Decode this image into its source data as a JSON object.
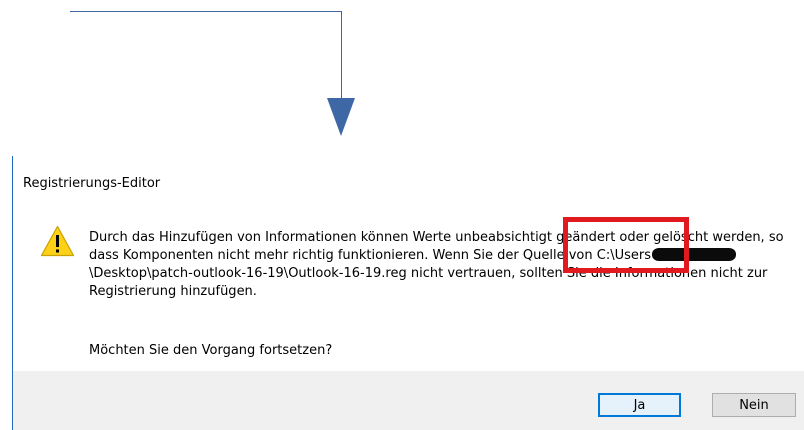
{
  "dialog": {
    "title": "Registrierungs-Editor",
    "message_part1": "Durch das Hinzufügen von Informationen können Werte unbeabsichtigt geändert oder gelöscht werden, so dass Komponenten nicht mehr richtig funktionieren. Wenn Sie der Quelle von C:\\Users",
    "message_part2": "\\Desktop\\patch-outlook-16-19\\Outlook-16-19.reg nicht vertrauen, sollten Sie die Informationen nicht zur Registrierung hinzufügen.",
    "question": "Möchten Sie den Vorgang fortsetzen?",
    "buttons": {
      "yes_label": "Ja",
      "no_label": "Nein"
    },
    "icon": "warning-icon"
  },
  "annotation": {
    "arrow_color": "#3d68a5",
    "highlight_color": "#e01a1f"
  }
}
